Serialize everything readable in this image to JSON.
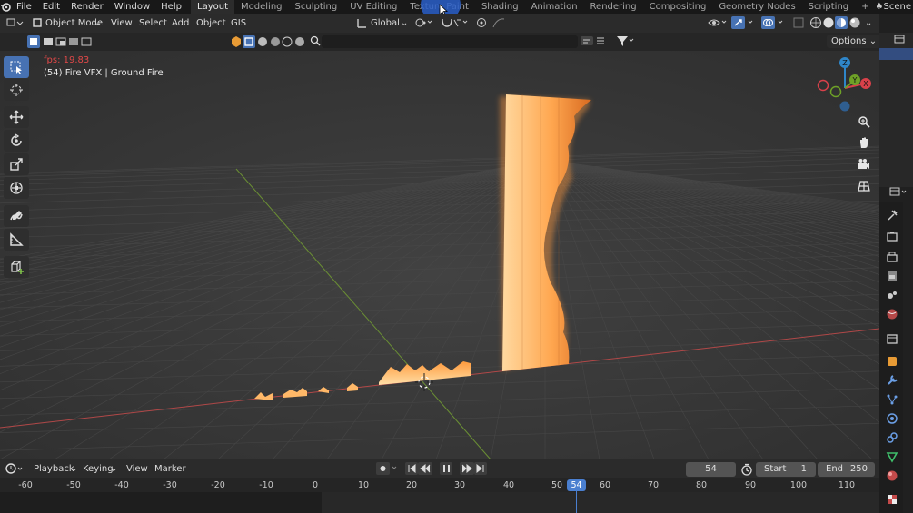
{
  "menubar": {
    "items": [
      "File",
      "Edit",
      "Render",
      "Window",
      "Help"
    ],
    "workspaces": [
      "Layout",
      "Modeling",
      "Sculpting",
      "UV Editing",
      "Texture Paint",
      "Shading",
      "Animation",
      "Rendering",
      "Compositing",
      "Geometry Nodes",
      "Scripting"
    ],
    "active_workspace": "Layout",
    "plus": "+",
    "scene": "Scene"
  },
  "header": {
    "mode": "Object Mode",
    "menus": [
      "View",
      "Select",
      "Add",
      "Object",
      "GIS"
    ],
    "transform_orientation": "Global",
    "options": "Options"
  },
  "viewport": {
    "fps": "fps: 19.83",
    "object_info": "(54) Fire VFX | Ground Fire",
    "gizmo_labels": {
      "z": "Z",
      "x": "X",
      "y": "Y"
    },
    "colors": {
      "z": "#2f86c9",
      "x": "#d9414a",
      "y": "#6ea127",
      "fps_text": "#e04848",
      "fire": "#ffb060"
    }
  },
  "timeline": {
    "menus": [
      "Playback",
      "Keying",
      "View",
      "Marker"
    ],
    "current_frame": "54",
    "start_label": "Start",
    "start": "1",
    "end_label": "End",
    "end": "250",
    "ruler_ticks": [
      "-60",
      "-50",
      "-40",
      "-30",
      "-20",
      "-10",
      "0",
      "10",
      "20",
      "30",
      "40",
      "50",
      "60",
      "70",
      "80",
      "90",
      "100",
      "110"
    ],
    "playhead_label": "54"
  }
}
